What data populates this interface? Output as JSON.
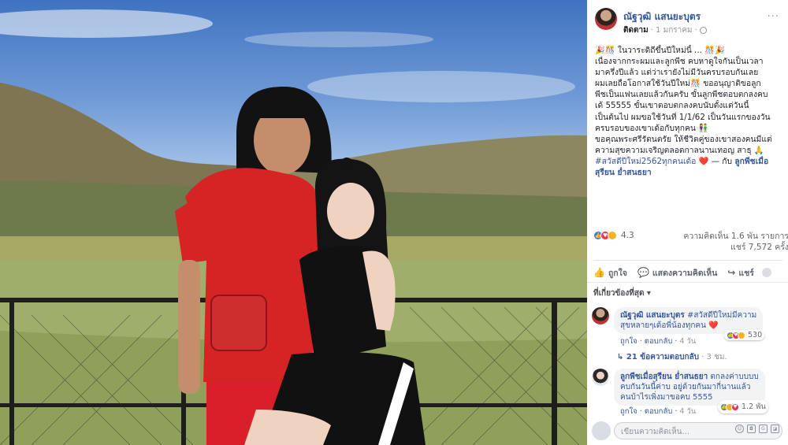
{
  "post": {
    "author": "ณัฐวุฒิ แสนยะบุตร",
    "follow": "ติดตาม",
    "timestamp": "· 1 มกราคม ·",
    "caption_lines": [
      "🎉🎊 ในวาระดิถีขึ้นปีใหม่นี้ ... 🎊🎉",
      "เนื่องจากกระผมและลูกพีช คบหาดูใจกันเป็นเวลา",
      "มาครึ่งปีแล้ว แต่ว่าเรายังไม่มีวันครบรอบกันเลย",
      "ผมเลยถือโอกาสใช้วันปีใหม่🎊 ขออนุญาติขอลูก",
      "พีชเป็นแฟนเลยแล้วกันครับ ขั้นลูกพีชตอบตกลงคบ",
      "เด้ 55555 ขั้นเขาตอบตกลงคบนับตั้งแต่วันนี้",
      "เป็นต้นไป ผมขอใช้วันที่ 1/1/62 เป็นวันแรกของวัน",
      "ครบรอบของเขาเด้อกับทุกคน 👫",
      "ขอคุณพระศรีรัตนตรัย ให้ชีวิตคู่ของเขาสองคนมีแต่",
      "ความสุขความเจริญตลอดกาลนานเทอญ สาธุ 🙏"
    ],
    "hashtag": "#สวัสดีปีใหม่2562ทุกคนเด้อ ❤️",
    "with_prefix": " — กับ ",
    "tagged": "ลูกพีชเมื่อ",
    "tagged_line2": "สุรียน ย่ำสนธยา"
  },
  "stats": {
    "reaction_count": "4.3",
    "comments": "ความคิดเห็น 1.6 พัน รายการ",
    "shares": "แชร์ 7,572 ครั้ง"
  },
  "actions": {
    "like": "ถูกใจ",
    "comment": "แสดงความคิดเห็น",
    "share": "แชร์"
  },
  "relevant_label": "ที่เกี่ยวข้องที่สุด ▾",
  "comments": [
    {
      "name": "ณัฐวุฒิ แสนยะบุตร",
      "text_line1": " #สวัสดีปีใหม่มีความ",
      "text_line2": "สุขหลายๆเด้อพี่น้องทุกคน ❤️",
      "reactions": "530",
      "like_label": "ถูกใจ",
      "reply_label": "ตอบกลับ",
      "time": "4 วัน"
    },
    {
      "name": "ลูกพีชเมื่อสุรียน ย่ำสนธยา",
      "text_line1": " ตกลงค่าบบบบ",
      "text_line2": "คบกันวันนี้ค่าบ อยู่ด้วยกันมากี่นานแล้ว",
      "text_line3": "คนบ้าไรเพิ่งมาขอคบ 5555",
      "reactions": "1.2 พัน",
      "like_label": "ถูกใจ",
      "reply_label": "ตอบกลับ",
      "time": "4 วัน"
    }
  ],
  "replies": {
    "label": "↳ 21 ข้อความตอบกลับ",
    "time": " · 3 ชม."
  },
  "compose": {
    "placeholder": "เขียนความคิดเห็น..."
  },
  "colors": {
    "link": "#365899",
    "like_blue": "#3b7ddd",
    "love_red": "#e5374f"
  }
}
